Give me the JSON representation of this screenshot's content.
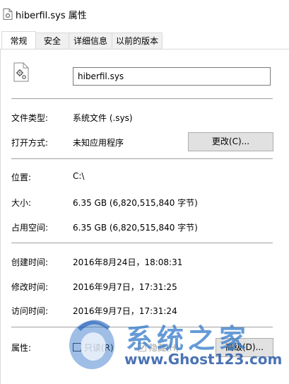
{
  "window": {
    "title": "hiberfil.sys 属性"
  },
  "tabs": [
    {
      "label": "常规",
      "active": true
    },
    {
      "label": "安全",
      "active": false
    },
    {
      "label": "详细信息",
      "active": false
    },
    {
      "label": "以前的版本",
      "active": false
    }
  ],
  "general": {
    "file_name": "hiberfil.sys",
    "type_label": "文件类型:",
    "type_value": "系统文件 (.sys)",
    "open_with_label": "打开方式:",
    "open_with_value": "未知应用程序",
    "change_button": "更改(C)...",
    "location_label": "位置:",
    "location_value": "C:\\",
    "size_label": "大小:",
    "size_value": "6.35 GB (6,820,515,840 字节)",
    "size_on_disk_label": "占用空间:",
    "size_on_disk_value": "6.35 GB (6,820,515,840 字节)",
    "created_label": "创建时间:",
    "created_value": "2016年8月24日，18:08:31",
    "modified_label": "修改时间:",
    "modified_value": "2016年9月7日，17:31:25",
    "accessed_label": "访问时间:",
    "accessed_value": "2016年9月7日，17:31:24",
    "attributes_label": "属性:",
    "readonly_label": "只读(R)",
    "readonly_checked": false,
    "hidden_label": "隐藏(H)",
    "hidden_checked": true,
    "advanced_button": "高级(D)..."
  },
  "watermark": {
    "text": "系统之家",
    "url": "www.Ghost123.com"
  },
  "icons": {
    "title": "system-file-icon",
    "file": "gear-file-icon",
    "check": "checkmark-icon"
  }
}
